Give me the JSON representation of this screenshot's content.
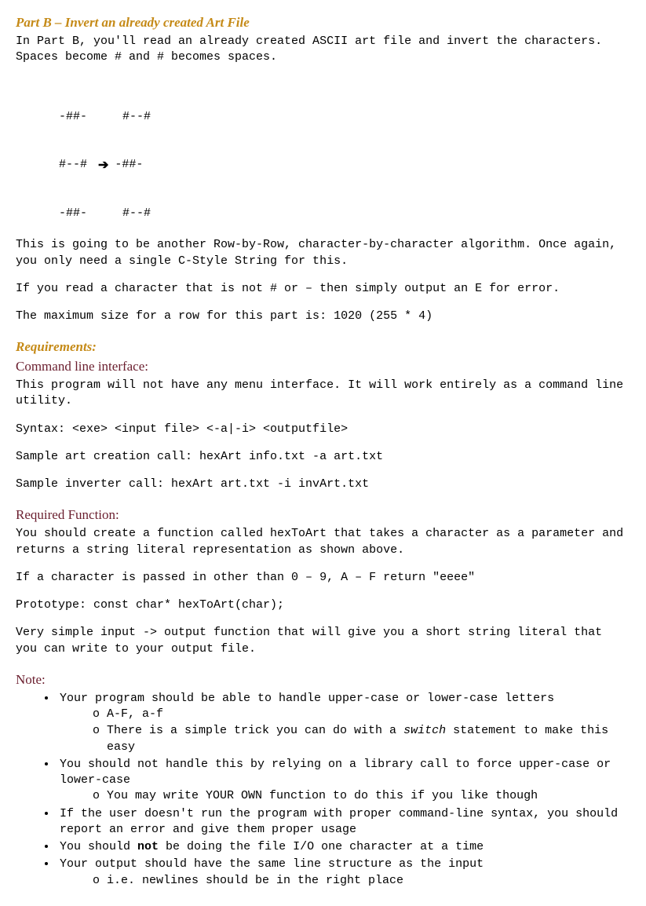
{
  "partB": {
    "heading": "Part B – Invert an already created Art File",
    "intro": "In Part B, you'll read an already created ASCII art file and invert the characters.  Spaces become # and # becomes spaces.",
    "art": {
      "l1a": "-##-",
      "l1b": "#--#",
      "l2a": "#--#",
      "l2arrow": "➔",
      "l2b": "-##-",
      "l3a": "-##-",
      "l3b": "#--#"
    },
    "rowByRow": "This is going to be another Row-by-Row, character-by-character algorithm.  Once again, you only need a single C-Style String for this.",
    "errorLine": "If you read a character that is not # or – then simply output an E for error.",
    "maxSize": "The maximum size for a row for this part is: 1020 (255 * 4)"
  },
  "requirements": {
    "heading": "Requirements:",
    "cli": {
      "heading": "Command line interface:",
      "desc": "This program will not have any menu interface.  It will work entirely as a command line utility.",
      "syntax": "Syntax: <exe> <input file> <-a|-i> <outputfile>",
      "sampleArt": "Sample art creation call: hexArt info.txt -a art.txt",
      "sampleInv": "Sample inverter call: hexArt art.txt -i invArt.txt"
    },
    "reqFunc": {
      "heading": "Required Function:",
      "desc": "You should create a function called hexToArt that takes a character as a parameter and returns a string literal representation as shown above.",
      "eeee": "If a character is passed in other than 0 – 9, A – F return \"eeee\"",
      "proto": "Prototype: const char* hexToArt(char);",
      "simple": "Very simple input -> output function that will give you a short string literal that you can write to your output file."
    },
    "note": {
      "heading": "Note:",
      "b1": "Your program should be able to handle upper-case or lower-case letters",
      "b1a": "A-F, a-f",
      "b1b_pre": "There is a simple trick you can do with a ",
      "b1b_switch": "switch",
      "b1b_post": " statement to make this easy",
      "b2": "You should not handle this by relying on a library call to force upper-case or lower-case",
      "b2a": "You may write YOUR OWN function to do this if you like though",
      "b3": "If the user doesn't run the program with proper command-line syntax, you should report an error and give them proper usage",
      "b4_pre": "You should ",
      "b4_not": "not",
      "b4_post": " be doing the file I/O one character at a time",
      "b5": "Your output should have the same line structure as the input",
      "b5a": "i.e. newlines should be in the right place"
    }
  }
}
